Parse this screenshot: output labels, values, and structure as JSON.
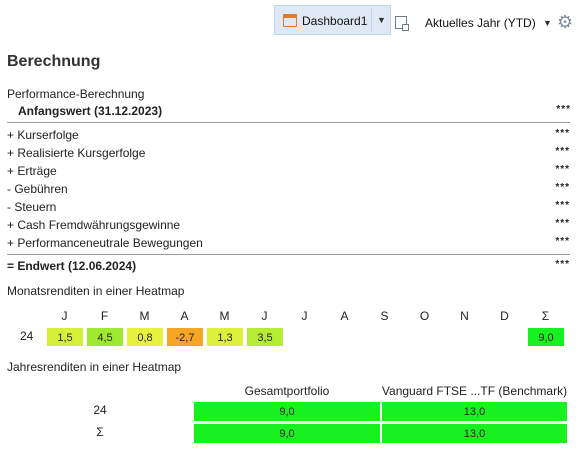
{
  "toolbar": {
    "dashboard_label": "Dashboard1",
    "period_label": "Aktuelles Jahr (YTD)",
    "icons": [
      "calendar-icon",
      "chevron-down-icon",
      "document-icon",
      "gear-icon"
    ]
  },
  "title": "Berechnung",
  "performance": {
    "heading": "Performance-Berechnung",
    "start": {
      "label": "Anfangswert (31.12.2023)",
      "value": "***"
    },
    "items": [
      {
        "label": "+ Kurserfolge",
        "value": "***"
      },
      {
        "label": "+ Realisierte Kursgerfolge",
        "value": "***"
      },
      {
        "label": "+ Erträge",
        "value": "***"
      },
      {
        "label": "-  Gebühren",
        "value": "***"
      },
      {
        "label": "-  Steuern",
        "value": "***"
      },
      {
        "label": "+ Cash Fremdwährungsgewinne",
        "value": "***"
      },
      {
        "label": "+ Performanceneutrale Bewegungen",
        "value": "***"
      }
    ],
    "end": {
      "label": "= Endwert (12.06.2024)",
      "value": "***"
    }
  },
  "monthly": {
    "heading": "Monatsrenditen in einer Heatmap",
    "months": [
      "J",
      "F",
      "M",
      "A",
      "M",
      "J",
      "J",
      "A",
      "S",
      "O",
      "N",
      "D",
      "Σ"
    ],
    "year": "24",
    "values": [
      "1,5",
      "4,5",
      "0,8",
      "-2,7",
      "1,3",
      "3,5",
      "",
      "",
      "",
      "",
      "",
      "",
      "9,0"
    ],
    "colors": [
      "#d6f03a",
      "#9fe830",
      "#e6f23e",
      "#f4a624",
      "#dcf03c",
      "#b6ec34",
      "",
      "",
      "",
      "",
      "",
      "",
      "#19f020"
    ]
  },
  "yearly": {
    "heading": "Jahresrenditen in einer Heatmap",
    "columns": [
      "Gesamtportfolio",
      "Vanguard FTSE ...TF (Benchmark)"
    ],
    "rows": [
      {
        "label": "24",
        "values": [
          "9,0",
          "13,0"
        ]
      },
      {
        "label": "Σ",
        "values": [
          "9,0",
          "13,0"
        ]
      }
    ]
  }
}
